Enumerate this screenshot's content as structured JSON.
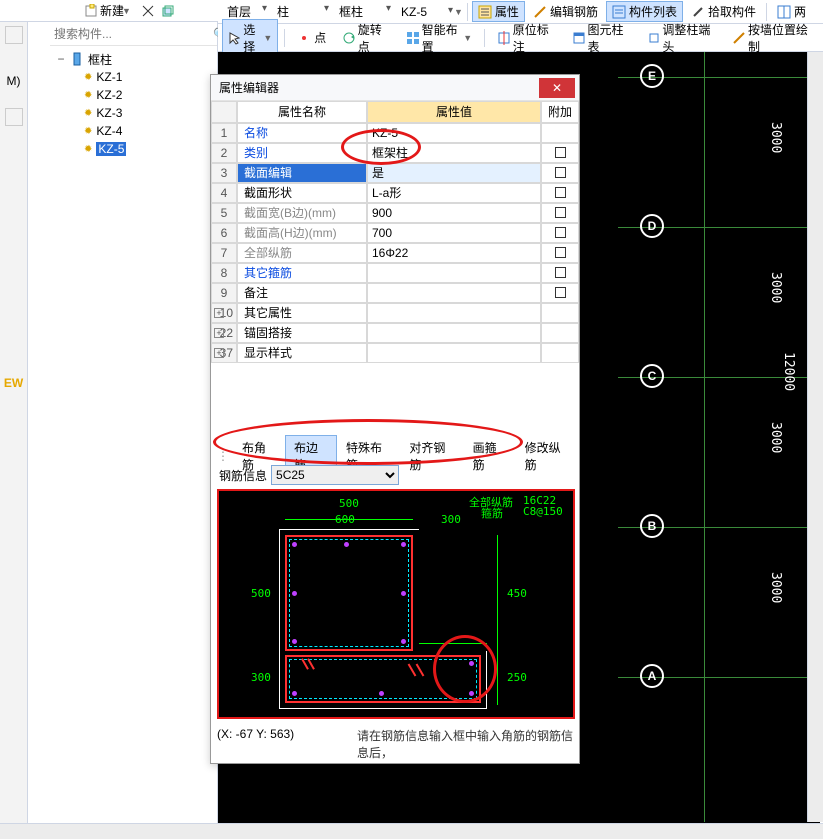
{
  "toolbarTop": {
    "new": "新建"
  },
  "sidebar": {
    "searchPlaceholder": "搜索构件...",
    "root": "框柱",
    "items": [
      "KZ-1",
      "KZ-2",
      "KZ-3",
      "KZ-4",
      "KZ-5"
    ],
    "selectedIndex": 4,
    "leftGutterLabels": [
      "",
      "",
      "M)",
      "",
      "",
      "EW"
    ]
  },
  "topDropdowns": [
    "首层",
    "柱",
    "框柱",
    "KZ-5"
  ],
  "toolbar1": {
    "attrs": "属性",
    "editRebar": "编辑钢筋",
    "componentList": "构件列表",
    "pick": "拾取构件",
    "twoPoint": "两"
  },
  "toolbar2": {
    "select": "选择",
    "point": "点",
    "rotatePoint": "旋转点",
    "smartArrange": "智能布置",
    "originMark": "原位标注",
    "columnSheet": "图元柱表",
    "adjustEnd": "调整柱端头",
    "byPosition": "按墙位置绘制"
  },
  "propertyEditor": {
    "title": "属性编辑器",
    "headers": {
      "name": "属性名称",
      "value": "属性值",
      "extra": "附加"
    },
    "rows": [
      {
        "n": "1",
        "name": "名称",
        "value": "KZ-5",
        "blue": true
      },
      {
        "n": "2",
        "name": "类别",
        "value": "框架柱",
        "blue": true,
        "chk": true
      },
      {
        "n": "3",
        "name": "截面编辑",
        "value": "是",
        "sel": true,
        "chk": true
      },
      {
        "n": "4",
        "name": "截面形状",
        "value": "L-a形",
        "chk": true
      },
      {
        "n": "5",
        "name": "截面宽(B边)(mm)",
        "value": "900",
        "gray": true,
        "chk": true
      },
      {
        "n": "6",
        "name": "截面高(H边)(mm)",
        "value": "700",
        "gray": true,
        "chk": true
      },
      {
        "n": "7",
        "name": "全部纵筋",
        "value": "16Φ22",
        "gray": true,
        "chk": true
      },
      {
        "n": "8",
        "name": "其它箍筋",
        "value": "",
        "blue": true,
        "chk": true
      },
      {
        "n": "9",
        "name": "备注",
        "value": "",
        "chk": true
      },
      {
        "n": "10",
        "name": "其它属性",
        "value": "",
        "group": true
      },
      {
        "n": "22",
        "name": "锚固搭接",
        "value": "",
        "group": true
      },
      {
        "n": "37",
        "name": "显示样式",
        "value": "",
        "group": true
      }
    ]
  },
  "rebarTabs": {
    "items": [
      "布角筋",
      "布边筋",
      "特殊布筋",
      "对齐钢筋",
      "画箍筋",
      "修改纵筋"
    ],
    "activeIndex": 1
  },
  "rebarInfo": {
    "label": "钢筋信息",
    "value": "5C25"
  },
  "diagram": {
    "dims": {
      "top1": "500",
      "top2": "600",
      "top3": "300",
      "right1": "450",
      "right2": "250",
      "left1": "500",
      "left2": "300"
    },
    "legend": {
      "l1": "全部纵筋",
      "l2": "箍筋",
      "v1": "16C22",
      "v2": "C8@150"
    }
  },
  "status": {
    "coord": "(X: -67 Y: 563)",
    "msg": "请在钢筋信息输入框中输入角筋的钢筋信息后，"
  },
  "canvas": {
    "gridLabels": [
      "E",
      "D",
      "C",
      "B",
      "A"
    ],
    "dims": [
      "3000",
      "3000",
      "12000",
      "3000",
      "3000"
    ]
  }
}
